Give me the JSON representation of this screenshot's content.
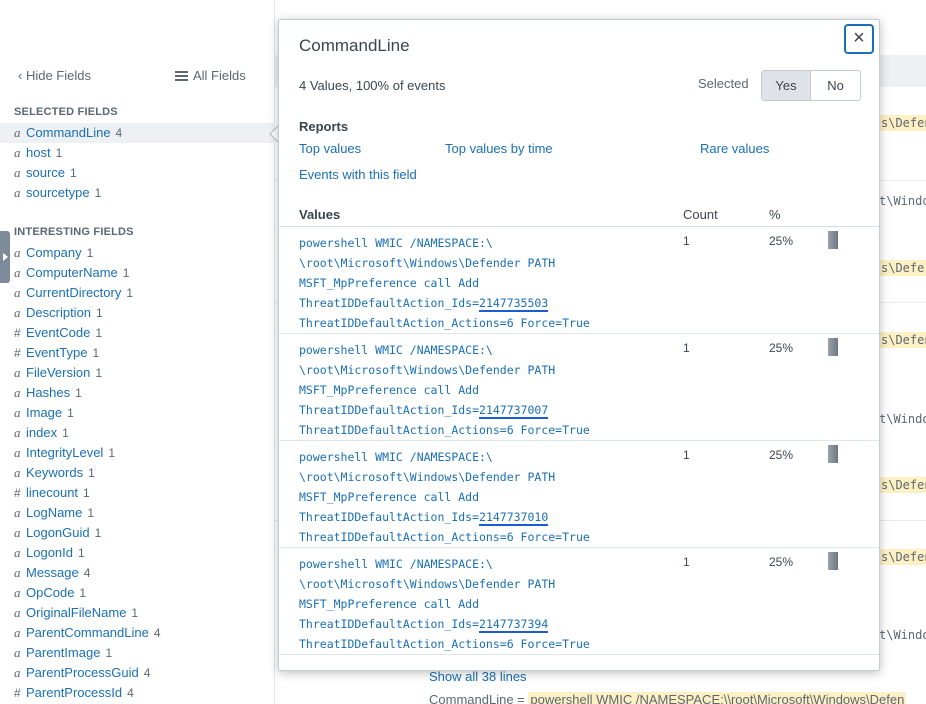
{
  "sidebar": {
    "hide_fields": "Hide Fields",
    "all_fields": "All Fields",
    "selected_heading": "SELECTED FIELDS",
    "interesting_heading": "INTERESTING FIELDS",
    "selected_fields": [
      {
        "type": "a",
        "name": "CommandLine",
        "count": "4"
      },
      {
        "type": "a",
        "name": "host",
        "count": "1"
      },
      {
        "type": "a",
        "name": "source",
        "count": "1"
      },
      {
        "type": "a",
        "name": "sourcetype",
        "count": "1"
      }
    ],
    "interesting_fields": [
      {
        "type": "a",
        "name": "Company",
        "count": "1"
      },
      {
        "type": "a",
        "name": "ComputerName",
        "count": "1"
      },
      {
        "type": "a",
        "name": "CurrentDirectory",
        "count": "1"
      },
      {
        "type": "a",
        "name": "Description",
        "count": "1"
      },
      {
        "type": "#",
        "name": "EventCode",
        "count": "1"
      },
      {
        "type": "#",
        "name": "EventType",
        "count": "1"
      },
      {
        "type": "a",
        "name": "FileVersion",
        "count": "1"
      },
      {
        "type": "a",
        "name": "Hashes",
        "count": "1"
      },
      {
        "type": "a",
        "name": "Image",
        "count": "1"
      },
      {
        "type": "a",
        "name": "index",
        "count": "1"
      },
      {
        "type": "a",
        "name": "IntegrityLevel",
        "count": "1"
      },
      {
        "type": "a",
        "name": "Keywords",
        "count": "1"
      },
      {
        "type": "#",
        "name": "linecount",
        "count": "1"
      },
      {
        "type": "a",
        "name": "LogName",
        "count": "1"
      },
      {
        "type": "a",
        "name": "LogonGuid",
        "count": "1"
      },
      {
        "type": "a",
        "name": "LogonId",
        "count": "1"
      },
      {
        "type": "a",
        "name": "Message",
        "count": "4"
      },
      {
        "type": "a",
        "name": "OpCode",
        "count": "1"
      },
      {
        "type": "a",
        "name": "OriginalFileName",
        "count": "1"
      },
      {
        "type": "a",
        "name": "ParentCommandLine",
        "count": "4"
      },
      {
        "type": "a",
        "name": "ParentImage",
        "count": "1"
      },
      {
        "type": "a",
        "name": "ParentProcessGuid",
        "count": "4"
      },
      {
        "type": "#",
        "name": "ParentProcessId",
        "count": "4"
      }
    ]
  },
  "background": {
    "snippets": [
      "s\\Defen",
      "t\\Windo",
      "s\\Defer",
      "s\\Defen",
      "t\\Windo",
      "s\\Defen",
      "s\\Defen",
      "t\\Windo",
      "s\\Defen"
    ],
    "show_all": "Show all 38 lines",
    "cmd_prefix": "CommandLine = ",
    "cmd_value": "powershell WMIC /NAMESPACE:\\\\root\\Microsoft\\Windows\\Defen"
  },
  "popup": {
    "title": "CommandLine",
    "close_glyph": "×",
    "summary": "4 Values, 100% of events",
    "selected_label": "Selected",
    "yes": "Yes",
    "no": "No",
    "reports_title": "Reports",
    "reports": {
      "top_values": "Top values",
      "top_by_time": "Top values by time",
      "rare_values": "Rare values",
      "events_with_field": "Events with this field"
    },
    "columns": {
      "values": "Values",
      "count": "Count",
      "pct": "%"
    },
    "rows": [
      {
        "line1": "powershell WMIC /NAMESPACE:\\",
        "line2": "\\root\\Microsoft\\Windows\\Defender PATH",
        "line3": "MSFT_MpPreference call Add",
        "line4_prefix": "ThreatIDDefaultAction_Ids=",
        "id": "2147735503",
        "line5": "ThreatIDDefaultAction_Actions=6 Force=True",
        "count": "1",
        "pct": "25%",
        "pct_value": 25
      },
      {
        "line1": "powershell WMIC /NAMESPACE:\\",
        "line2": "\\root\\Microsoft\\Windows\\Defender PATH",
        "line3": "MSFT_MpPreference call Add",
        "line4_prefix": "ThreatIDDefaultAction_Ids=",
        "id": "2147737007",
        "line5": "ThreatIDDefaultAction_Actions=6 Force=True",
        "count": "1",
        "pct": "25%",
        "pct_value": 25
      },
      {
        "line1": "powershell WMIC /NAMESPACE:\\",
        "line2": "\\root\\Microsoft\\Windows\\Defender PATH",
        "line3": "MSFT_MpPreference call Add",
        "line4_prefix": "ThreatIDDefaultAction_Ids=",
        "id": "2147737010",
        "line5": "ThreatIDDefaultAction_Actions=6 Force=True",
        "count": "1",
        "pct": "25%",
        "pct_value": 25
      },
      {
        "line1": "powershell WMIC /NAMESPACE:\\",
        "line2": "\\root\\Microsoft\\Windows\\Defender PATH",
        "line3": "MSFT_MpPreference call Add",
        "line4_prefix": "ThreatIDDefaultAction_Ids=",
        "id": "2147737394",
        "line5": "ThreatIDDefaultAction_Actions=6 Force=True",
        "count": "1",
        "pct": "25%",
        "pct_value": 25
      }
    ]
  }
}
